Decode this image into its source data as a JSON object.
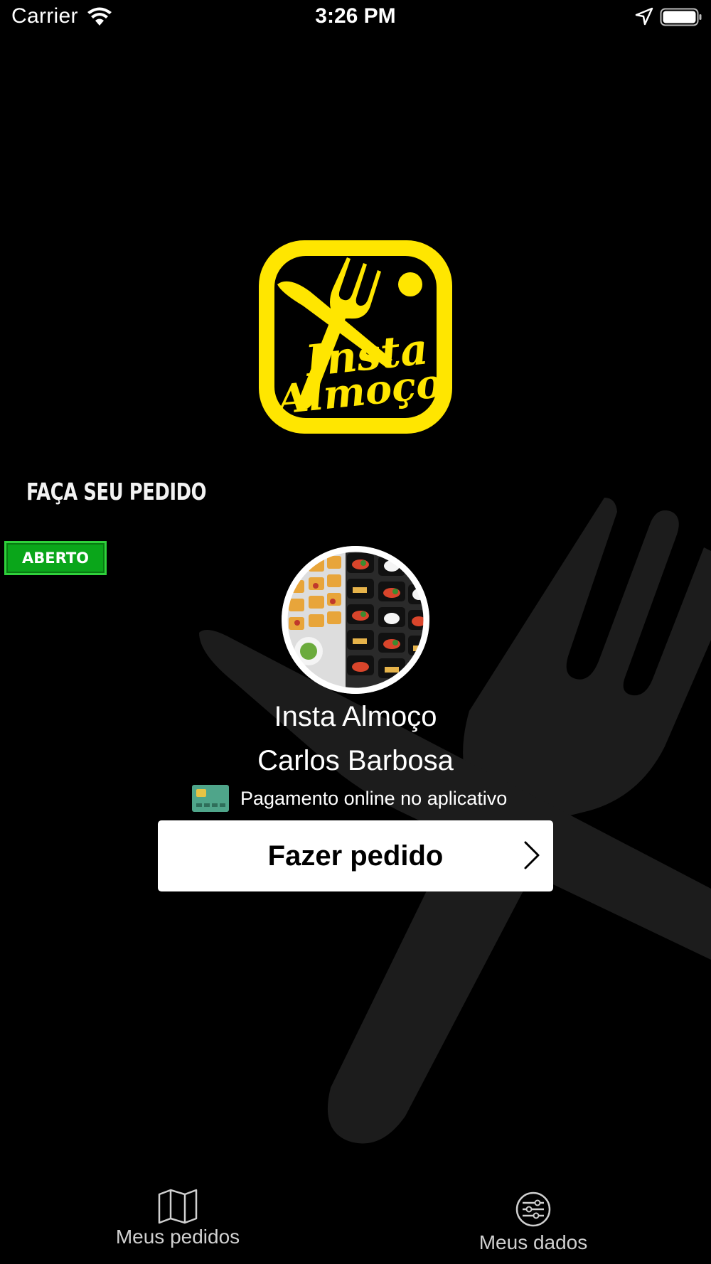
{
  "status_bar": {
    "carrier": "Carrier",
    "time": "3:26 PM",
    "icons": [
      "wifi-icon",
      "location-arrow-icon",
      "battery-icon"
    ]
  },
  "brand": {
    "logo_text": [
      "Insta",
      "Almoço"
    ],
    "logo_color": "#FFE600"
  },
  "main": {
    "heading": "FAÇA SEU PEDIDO",
    "status_badge": "ABERTO",
    "status_color": "#0AA61A",
    "restaurant_name": "Insta Almoço",
    "restaurant_city": "Carlos Barbosa",
    "payment_text": "Pagamento online no aplicativo",
    "order_button": "Fazer pedido"
  },
  "tab_bar": {
    "items": [
      {
        "label": "Meus pedidos",
        "icon": "map-icon"
      },
      {
        "label": "Meus dados",
        "icon": "sliders-icon"
      }
    ]
  }
}
